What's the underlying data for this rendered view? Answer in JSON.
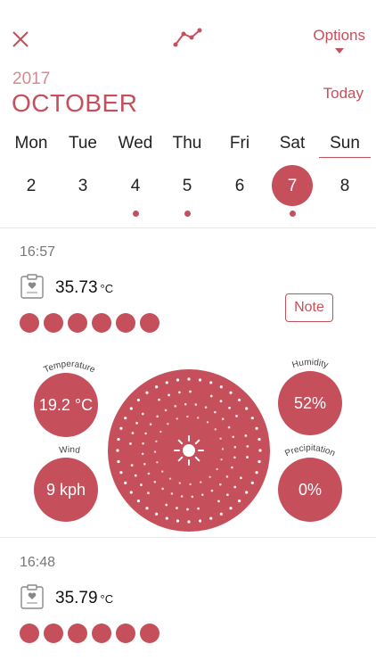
{
  "header": {
    "options_label": "Options",
    "close_icon": "close-icon",
    "graph_icon": "line-graph-icon"
  },
  "calendar": {
    "year": "2017",
    "month": "OCTOBER",
    "today_label": "Today",
    "weekdays": [
      "Mon",
      "Tue",
      "Wed",
      "Thu",
      "Fri",
      "Sat",
      "Sun"
    ],
    "days": [
      "2",
      "3",
      "4",
      "5",
      "6",
      "7",
      "8"
    ],
    "selected_day": "7",
    "active_weekday": "Sun",
    "days_with_entries": [
      "4",
      "5",
      "7"
    ]
  },
  "entries": [
    {
      "time": "16:57",
      "temperature": "35.73",
      "unit": "°C",
      "rating": 6,
      "note_label": "Note",
      "weather": {
        "temperature_label": "Temperature",
        "temperature_value": "19.2 °C",
        "humidity_label": "Humidity",
        "humidity_value": "52%",
        "wind_label": "Wind",
        "wind_value": "9 kph",
        "precipitation_label": "Precipitation",
        "precipitation_value": "0%",
        "center_icon": "sun-icon"
      }
    },
    {
      "time": "16:48",
      "temperature": "35.79",
      "unit": "°C",
      "rating": 6
    }
  ],
  "colors": {
    "accent": "#c5505c",
    "accent_light": "#d48a92"
  }
}
